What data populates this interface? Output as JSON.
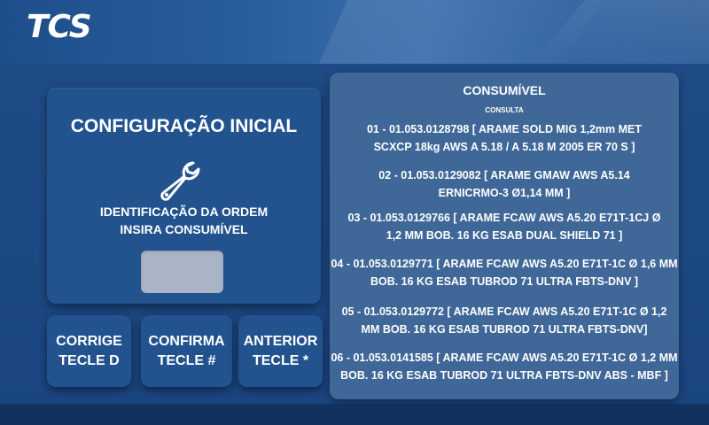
{
  "header": {
    "logo_text": "TCS"
  },
  "config": {
    "title": "CONFIGURAÇÃO INICIAL",
    "icon": "wrench-icon",
    "prompt_line1": "IDENTIFICAÇÃO DA ORDEM",
    "prompt_line2": "INSIRA CONSUMÍVEL",
    "entry_value": ""
  },
  "keys": [
    {
      "line1": "CORRIGE",
      "line2": "TECLE D"
    },
    {
      "line1": "CONFIRMA",
      "line2": "TECLE #"
    },
    {
      "line1": "ANTERIOR",
      "line2": "TECLE *"
    }
  ],
  "consumables": {
    "title": "CONSUMÍVEL",
    "subtitle": "CONSULTA",
    "items": [
      {
        "line1": "01 - 01.053.0128798 [ ARAME SOLD MIG 1,2mm MET",
        "line2": "SCXCP 18kg AWS A 5.18 / A 5.18 M 2005 ER 70 S ]"
      },
      {
        "line1": "02 - 01.053.0129082 [ ARAME GMAW AWS A5.14",
        "line2": "ERNICRMO-3 Ø1,14 MM ]"
      },
      {
        "line1": "03 - 01.053.0129766 [ ARAME FCAW AWS A5.20 E71T-1CJ Ø",
        "line2": "1,2 MM BOB. 16 KG ESAB DUAL SHIELD 71 ]"
      },
      {
        "line1": "04 - 01.053.0129771 [ ARAME FCAW AWS A5.20 E71T-1C Ø 1,6 MM",
        "line2": "BOB. 16 KG ESAB TUBROD 71 ULTRA FBTS-DNV ]"
      },
      {
        "line1": "05 - 01.053.0129772 [ ARAME FCAW AWS A5.20 E71T-1C Ø 1,2",
        "line2": "MM BOB. 16 KG ESAB TUBROD 71 ULTRA FBTS-DNV]"
      },
      {
        "line1": "06 - 01.053.0141585 [ ARAME FCAW AWS A5.20 E71T-1C Ø 1,2 MM",
        "line2": "BOB. 16 KG ESAB TUBROD 71 ULTRA FBTS-DNV ABS - MBF ]"
      }
    ]
  },
  "colors": {
    "background": "#1f4b86",
    "card": "#22538f",
    "panel": "#3f6797",
    "input": "#a9b4c6",
    "text": "#ffffff"
  }
}
